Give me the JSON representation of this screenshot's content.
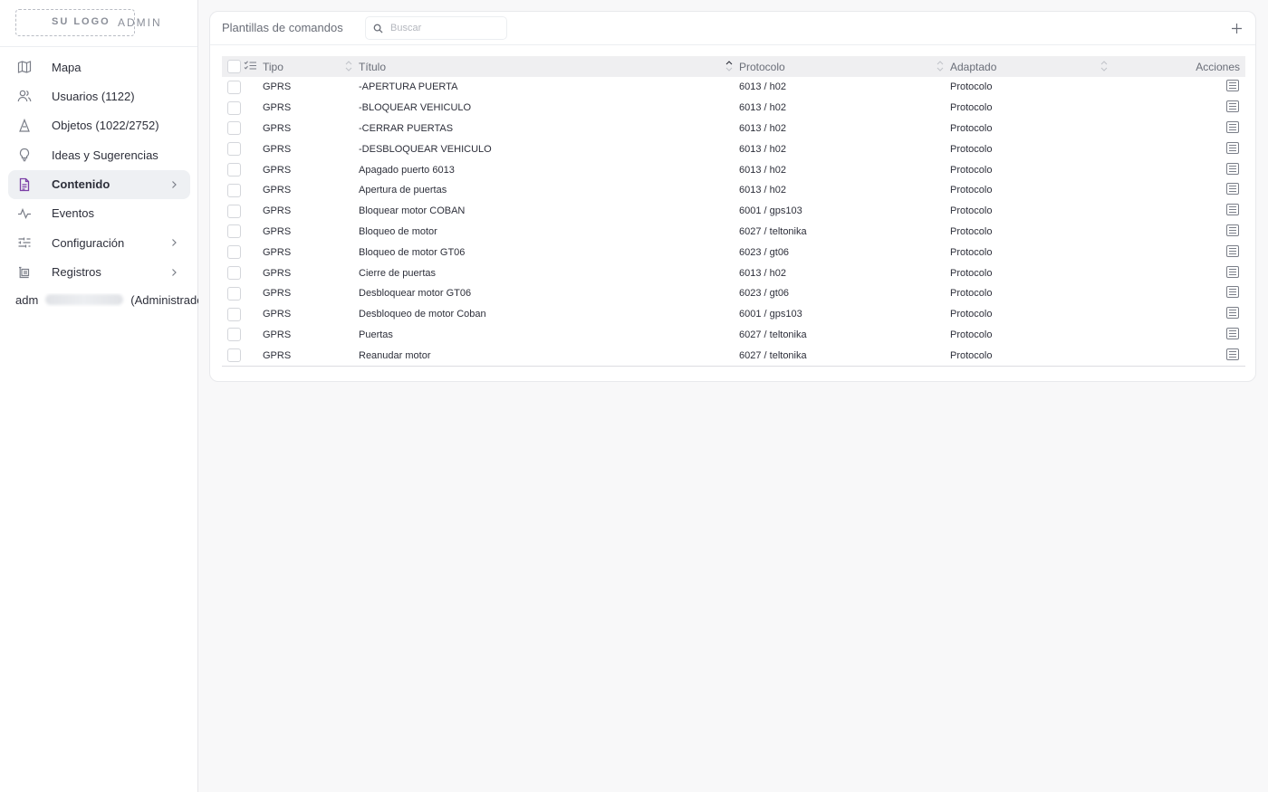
{
  "brand": {
    "logo_text": "SU LOGO",
    "admin_text": "ADMIN"
  },
  "sidebar": {
    "items": [
      {
        "label": "Mapa",
        "icon": "map-icon"
      },
      {
        "label": "Usuarios (1122)",
        "icon": "users-icon"
      },
      {
        "label": "Objetos (1022/2752)",
        "icon": "objects-icon"
      },
      {
        "label": "Ideas y Sugerencias",
        "icon": "lightbulb-icon"
      },
      {
        "label": "Contenido",
        "icon": "document-icon",
        "active": true
      },
      {
        "label": "Eventos",
        "icon": "activity-icon"
      },
      {
        "label": "Configuración",
        "icon": "sliders-icon"
      },
      {
        "label": "Registros",
        "icon": "registry-icon"
      }
    ],
    "user": {
      "prefix": "adm",
      "role": "(Administrador)"
    }
  },
  "card": {
    "title": "Plantillas de comandos",
    "search_placeholder": "Buscar"
  },
  "table": {
    "headers": {
      "tipo": "Tipo",
      "titulo": "Título",
      "protocolo": "Protocolo",
      "adaptado": "Adaptado",
      "acciones": "Acciones"
    },
    "rows": [
      {
        "tipo": "GPRS",
        "titulo": "-APERTURA PUERTA",
        "protocolo": "6013 / h02",
        "adaptado": "Protocolo"
      },
      {
        "tipo": "GPRS",
        "titulo": "-BLOQUEAR VEHICULO",
        "protocolo": "6013 / h02",
        "adaptado": "Protocolo"
      },
      {
        "tipo": "GPRS",
        "titulo": "-CERRAR PUERTAS",
        "protocolo": "6013 / h02",
        "adaptado": "Protocolo"
      },
      {
        "tipo": "GPRS",
        "titulo": "-DESBLOQUEAR VEHICULO",
        "protocolo": "6013 / h02",
        "adaptado": "Protocolo"
      },
      {
        "tipo": "GPRS",
        "titulo": "Apagado puerto 6013",
        "protocolo": "6013 / h02",
        "adaptado": "Protocolo"
      },
      {
        "tipo": "GPRS",
        "titulo": "Apertura de puertas",
        "protocolo": "6013 / h02",
        "adaptado": "Protocolo"
      },
      {
        "tipo": "GPRS",
        "titulo": "Bloquear motor COBAN",
        "protocolo": "6001 / gps103",
        "adaptado": "Protocolo"
      },
      {
        "tipo": "GPRS",
        "titulo": "Bloqueo de motor",
        "protocolo": "6027 / teltonika",
        "adaptado": "Protocolo"
      },
      {
        "tipo": "GPRS",
        "titulo": "Bloqueo de motor GT06",
        "protocolo": "6023 / gt06",
        "adaptado": "Protocolo"
      },
      {
        "tipo": "GPRS",
        "titulo": "Cierre de puertas",
        "protocolo": "6013 / h02",
        "adaptado": "Protocolo"
      },
      {
        "tipo": "GPRS",
        "titulo": "Desbloquear motor GT06",
        "protocolo": "6023 / gt06",
        "adaptado": "Protocolo"
      },
      {
        "tipo": "GPRS",
        "titulo": "Desbloqueo de motor Coban",
        "protocolo": "6001 / gps103",
        "adaptado": "Protocolo"
      },
      {
        "tipo": "GPRS",
        "titulo": "Puertas",
        "protocolo": "6027 / teltonika",
        "adaptado": "Protocolo"
      },
      {
        "tipo": "GPRS",
        "titulo": "Reanudar motor",
        "protocolo": "6027 / teltonika",
        "adaptado": "Protocolo"
      }
    ]
  },
  "colors": {
    "accent": "#7b3fa6",
    "text": "#2d2f3a",
    "muted": "#6a6e78",
    "header_bg": "#efeff1"
  }
}
